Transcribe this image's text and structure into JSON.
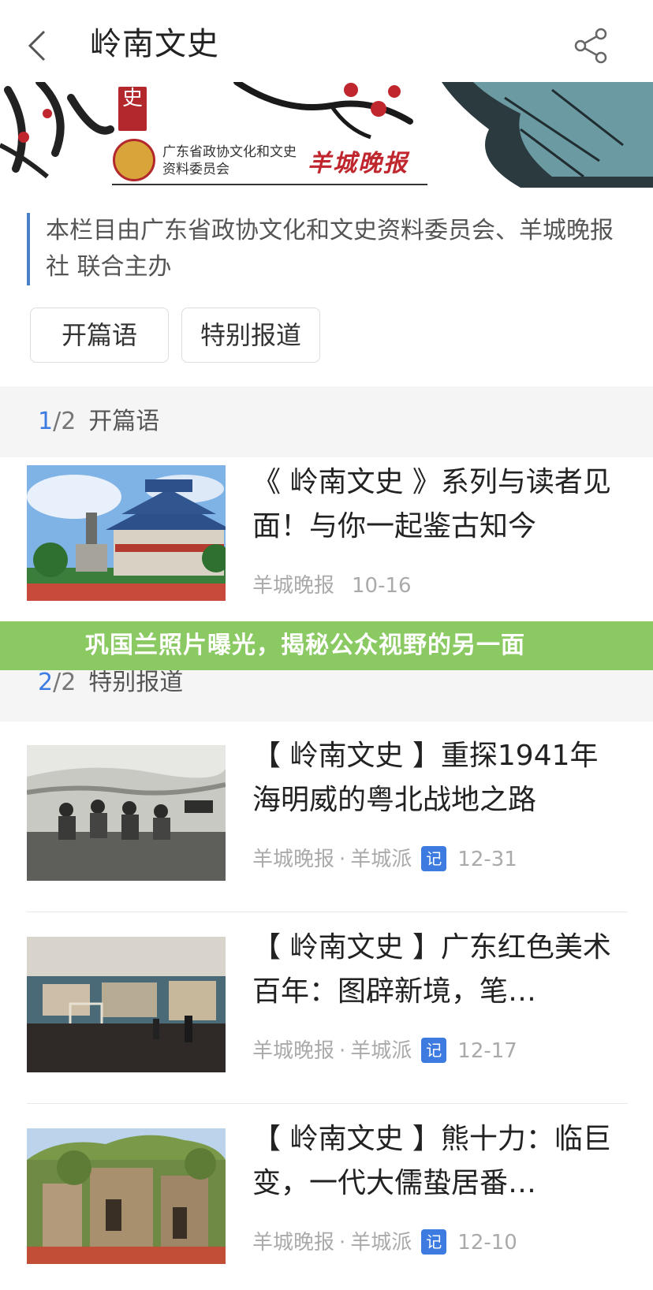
{
  "header": {
    "title": "岭南文史",
    "back_icon": "chevron-left-icon",
    "share_icon": "share-icon"
  },
  "banner": {
    "seal_text": "史",
    "org_name": "广东省政协文化和文史资料委员会",
    "paper_logo": "羊城晚报"
  },
  "intro": "本栏目由广东省政协文化和文史资料委员会、羊城晚报社 联合主办",
  "tags": [
    "开篇语",
    "特别报道"
  ],
  "sections": [
    {
      "current": "1",
      "total": "/2",
      "name": "开篇语",
      "articles": [
        {
          "title": "《 岭南文史 》系列与读者见面！与你一起鉴古知今",
          "source": "羊城晚报",
          "date": "10-16"
        }
      ]
    },
    {
      "current": "2",
      "total": "/2",
      "name": "特别报道",
      "articles": [
        {
          "title": "【 岭南文史 】重探1941年海明威的粤北战地之路",
          "source": "羊城晚报",
          "channel": "羊城派",
          "badge": "记",
          "date": "12-31"
        },
        {
          "title": "【 岭南文史 】广东红色美术百年：图辟新境，笔…",
          "source": "羊城晚报",
          "channel": "羊城派",
          "badge": "记",
          "date": "12-17"
        },
        {
          "title": "【 岭南文史 】熊十力：临巨变，一代大儒蛰居番…",
          "source": "羊城晚报",
          "channel": "羊城派",
          "badge": "记",
          "date": "12-10"
        }
      ]
    }
  ],
  "overlay": "巩国兰照片曝光，揭秘公众视野的另一面",
  "colors": {
    "accent": "#3d7be0",
    "overlay": "#8bc963",
    "seal": "#b3282d"
  }
}
